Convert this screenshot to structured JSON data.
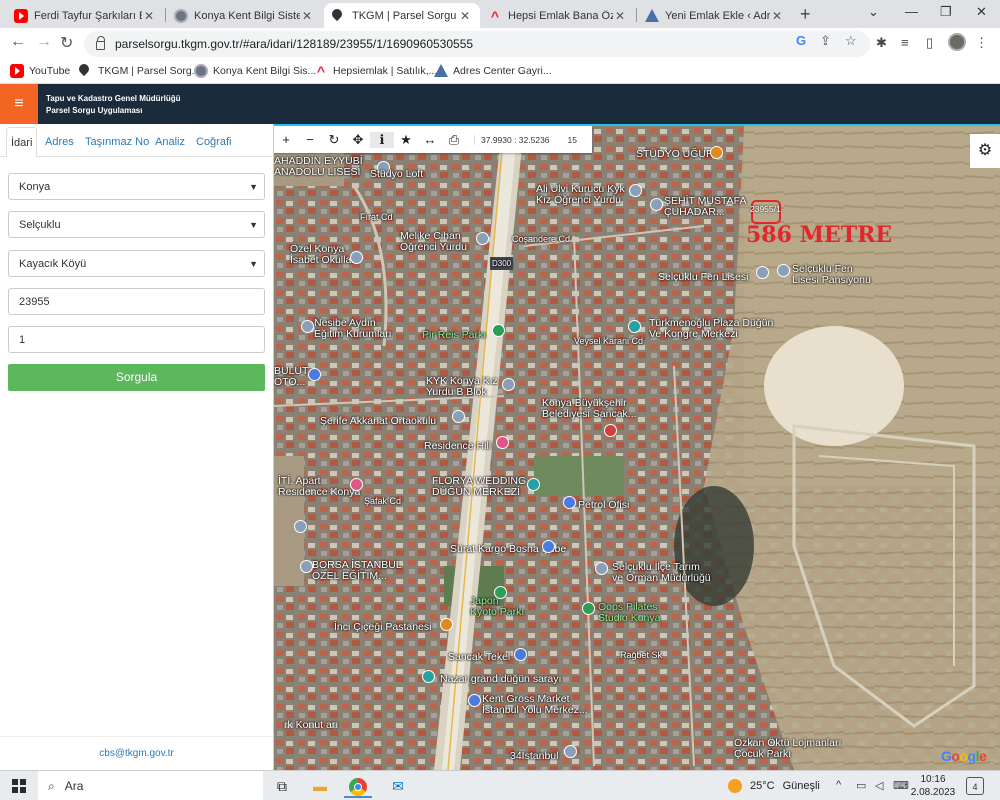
{
  "browser": {
    "tabs": [
      {
        "title": "Ferdi Tayfur Şarkıları E",
        "icon": "youtube-icon"
      },
      {
        "title": "Konya Kent Bilgi Sistemi",
        "icon": "kent-icon"
      },
      {
        "title": "TKGM | Parsel Sorgu Uyg",
        "icon": "location-pin-icon",
        "active": true
      },
      {
        "title": "Hepsi Emlak Bana Özel",
        "icon": "hepsiemlak-icon"
      },
      {
        "title": "Yeni Emlak Ekle ‹ Adres C",
        "icon": "adres-icon"
      }
    ],
    "url": "parselsorgu.tkgm.gov.tr/#ara/idari/128189/23955/1/1690960530555",
    "bookmarks": [
      {
        "label": "YouTube",
        "icon": "youtube-icon"
      },
      {
        "label": "TKGM | Parsel Sorg...",
        "icon": "location-pin-icon"
      },
      {
        "label": "Konya Kent Bilgi Sis...",
        "icon": "kent-icon"
      },
      {
        "label": "Hepsiemlak | Satılık,...",
        "icon": "hepsiemlak-icon"
      },
      {
        "label": "Adres Center Gayri...",
        "icon": "adres-icon"
      }
    ]
  },
  "app": {
    "title_line1": "Tapu ve Kadastro Genel Müdürlüğü",
    "title_line2": "Parsel Sorgu Uygulaması",
    "menu_icon": "hamburger-icon",
    "accent": "#f26522",
    "header_bg": "#1a2b3c"
  },
  "sidebar": {
    "tabs": [
      "İdari",
      "Adres",
      "Taşınmaz No",
      "Analiz",
      "Coğrafi"
    ],
    "active_tab": "İdari",
    "province": "Konya",
    "district": "Selçuklu",
    "neighborhood": "Kayacık Köyü",
    "block": "23955",
    "parcel": "1",
    "submit_label": "Sorgula",
    "submit_color": "#5cb85c",
    "footer_email": "cbs@tkgm.gov.tr"
  },
  "map": {
    "toolbar_icons": [
      "zoom-in-icon",
      "zoom-out-icon",
      "refresh-icon",
      "pan-icon",
      "info-icon",
      "star-icon",
      "measure-icon",
      "print-icon"
    ],
    "coordinates": "37.9930 : 32.5236",
    "zoom_level": "15",
    "parcel_label": "23955/1",
    "distance_label": "586 METRE",
    "attribution": "Google",
    "places": [
      "AHADDİN EYYUBİ\nANADOLU LİSESİ",
      "Stüdyo Loft",
      "STÜDYO UĞUR",
      "Ali Ulvi Kurucu Kyk\nKız Öğrenci Yurdu",
      "ŞEHİT MUSTAFA\nÇUHADAR...",
      "Melike Cihan\nÖğrenci Yurdu",
      "Coşandere Cd",
      "D300",
      "Özel Konya\nİsabet Okulları",
      "Selçuklu Fen Lisesi",
      "Selçuklu Fen\nLisesi Pansiyonu",
      "Nesibe Aydın\nEğitim Kurumları",
      "Pir Reis Parkı",
      "Türkmenoğlu Plaza Düğün\nVe Kongre Merkezi",
      "BULUT\nOTO...",
      "Veysel Karani Cd",
      "KYK Konya Kız\nYurdu B Blok",
      "Konya Büyükşehir\nBelediyesi Sancak...",
      "Şerife Akkanat Ortaokulu",
      "Residence Hill",
      "İTİ. Apart\nResidence Konya",
      "FLORYA WEDDING\nDÜĞÜN MERKEZİ",
      "Petrol Ofisi",
      "Sürat Kargo Bosna Şube",
      "Selçuklu İlçe Tarım\nve Orman Müdürlüğü",
      "BORSA İSTANBUL\nÖZEL EĞİTİM...",
      "Japon\nKyoto Parkı",
      "Oops Pilates\nStudio Konya",
      "İnci Çiçeği Pastanesi",
      "Sancak Tekel",
      "Rağbet Sk",
      "Nazar grand düğün sarayı",
      "Kent Gross Market\nİstanbul Yolu Merkez...",
      "rk Konut arı",
      "34İstanbul",
      "Özkan Öktü Lojmanları\nÇocuk Parkı",
      "Şafak Cd",
      "Fırat Cd"
    ]
  },
  "taskbar": {
    "search_placeholder": "Ara",
    "temperature": "25°C",
    "weather": "Güneşli",
    "time": "10:16",
    "date": "2.08.2023",
    "notifications": "4"
  }
}
